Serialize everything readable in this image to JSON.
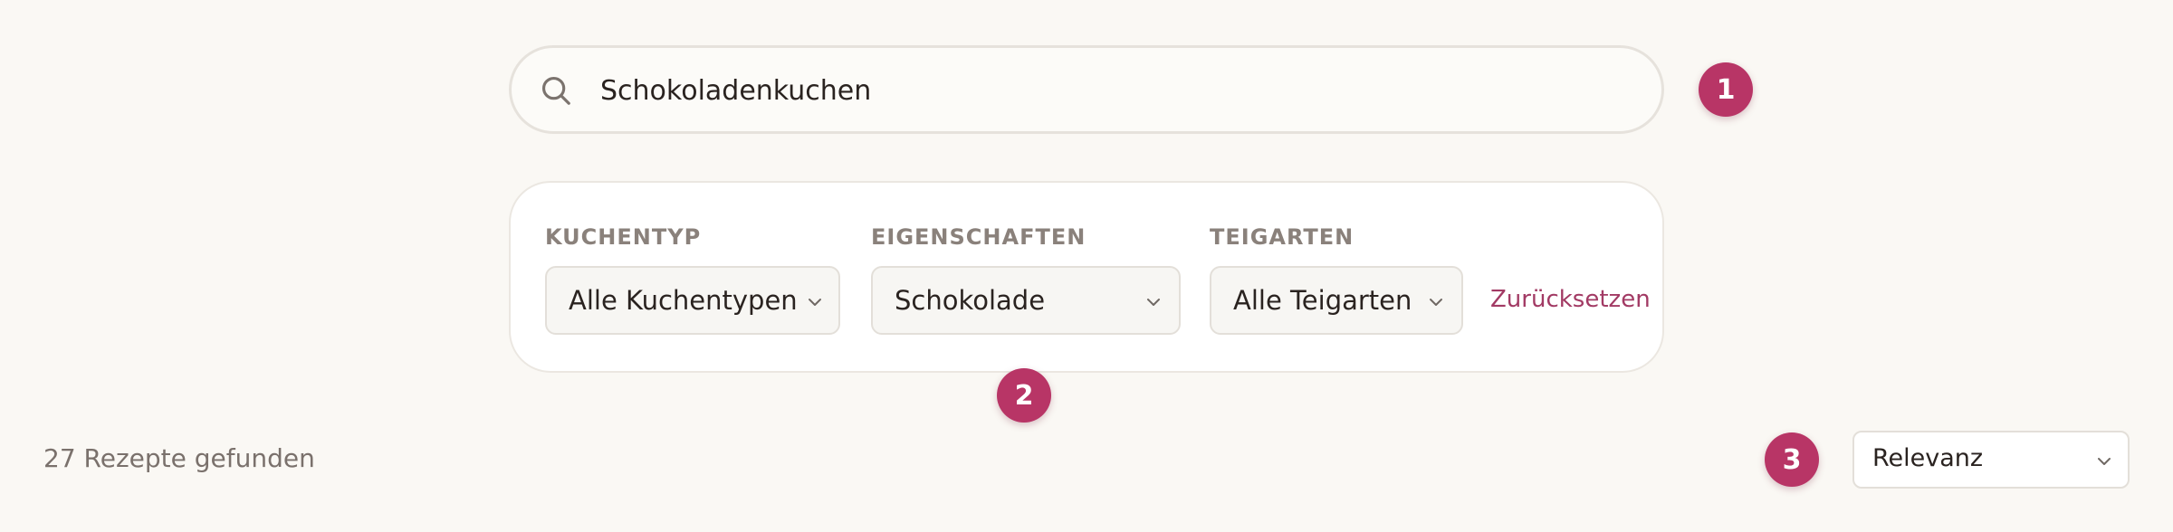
{
  "search": {
    "value": "Schokoladenkuchen",
    "icon": "search-icon"
  },
  "steps": {
    "one": "1",
    "two": "2",
    "three": "3"
  },
  "filters": {
    "kuchentyp": {
      "label": "KUCHENTYP",
      "selected": "Alle Kuchentypen"
    },
    "eigenschaften": {
      "label": "EIGENSCHAFTEN",
      "selected": "Schokolade"
    },
    "teigarten": {
      "label": "TEIGARTEN",
      "selected": "Alle Teigarten"
    },
    "reset_label": "Zurücksetzen"
  },
  "results": {
    "count_text": "27 Rezepte gefunden"
  },
  "sort": {
    "selected": "Relevanz"
  },
  "colors": {
    "accent": "#b83566",
    "link": "#a23a64",
    "background": "#faf8f4"
  }
}
